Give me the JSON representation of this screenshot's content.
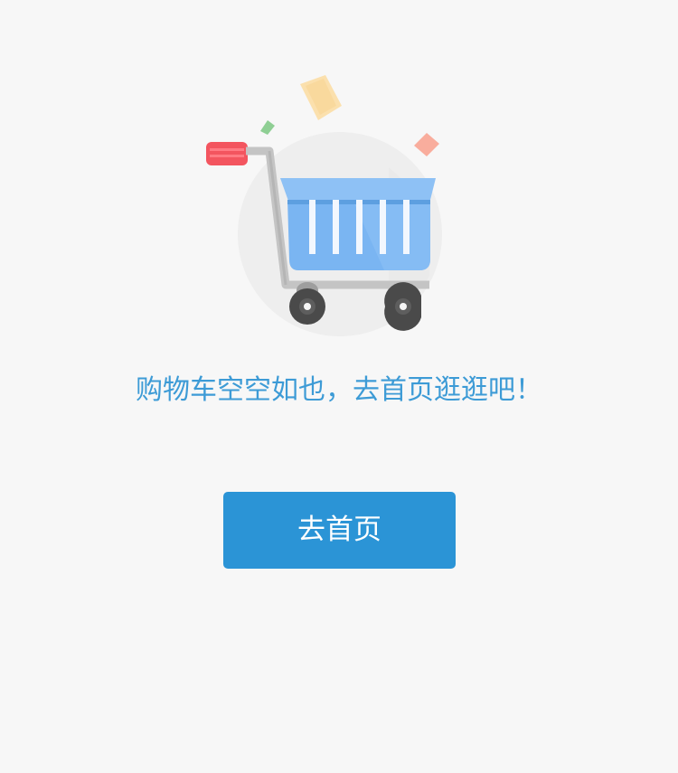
{
  "empty_state": {
    "illustration_icon": "shopping-cart-icon",
    "message": "购物车空空如也，去首页逛逛吧！"
  },
  "actions": {
    "home_button_label": "去首页"
  },
  "colors": {
    "background": "#f7f7f7",
    "message_text": "#3d9bd6",
    "button_background": "#2b94d6",
    "button_text": "#ffffff"
  }
}
